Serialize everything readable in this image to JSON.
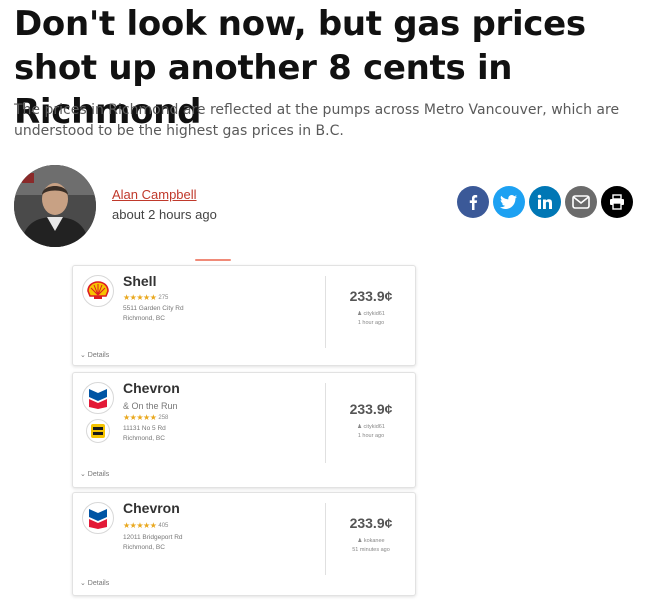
{
  "article": {
    "headline": "Don't look now, but gas prices shot up another 8 cents in Richmond",
    "subheadline": "The prices in Richmond are reflected at the pumps across Metro Vancouver, which are understood to be the highest gas prices in B.C."
  },
  "author": {
    "name": "Alan Campbell",
    "timestamp": "about 2 hours ago"
  },
  "share": {
    "icons": [
      "facebook-icon",
      "twitter-icon",
      "linkedin-icon",
      "email-icon",
      "print-icon"
    ],
    "colors": {
      "facebook": "#3b5998",
      "twitter": "#1da1f2",
      "linkedin": "#0077b5",
      "email": "#6b6b6b",
      "print": "#000000"
    }
  },
  "stations": [
    {
      "name": "Shell",
      "sub_brand": "",
      "logo": "shell-logo",
      "stars": "★★★★★",
      "rating_count": "275",
      "address_line1": "5511 Garden City Rd",
      "address_line2": "Richmond, BC",
      "price": "233.9¢",
      "reporter": "♟ citykid61",
      "reported": "1 hour ago",
      "details_label": "⌄ Details"
    },
    {
      "name": "Chevron",
      "sub_brand": "& On the Run",
      "logo": "chevron-logo",
      "secondary_logo": "on-the-run-logo",
      "stars": "★★★★★",
      "rating_count": "258",
      "address_line1": "11131 No 5 Rd",
      "address_line2": "Richmond, BC",
      "price": "233.9¢",
      "reporter": "♟ citykid61",
      "reported": "1 hour ago",
      "details_label": "⌄ Details"
    },
    {
      "name": "Chevron",
      "sub_brand": "",
      "logo": "chevron-logo",
      "stars": "★★★★★",
      "rating_count": "405",
      "address_line1": "12011 Bridgeport Rd",
      "address_line2": "Richmond, BC",
      "price": "233.9¢",
      "reporter": "♟ kokanee",
      "reported": "51 minutes ago",
      "details_label": "⌄ Details"
    }
  ]
}
